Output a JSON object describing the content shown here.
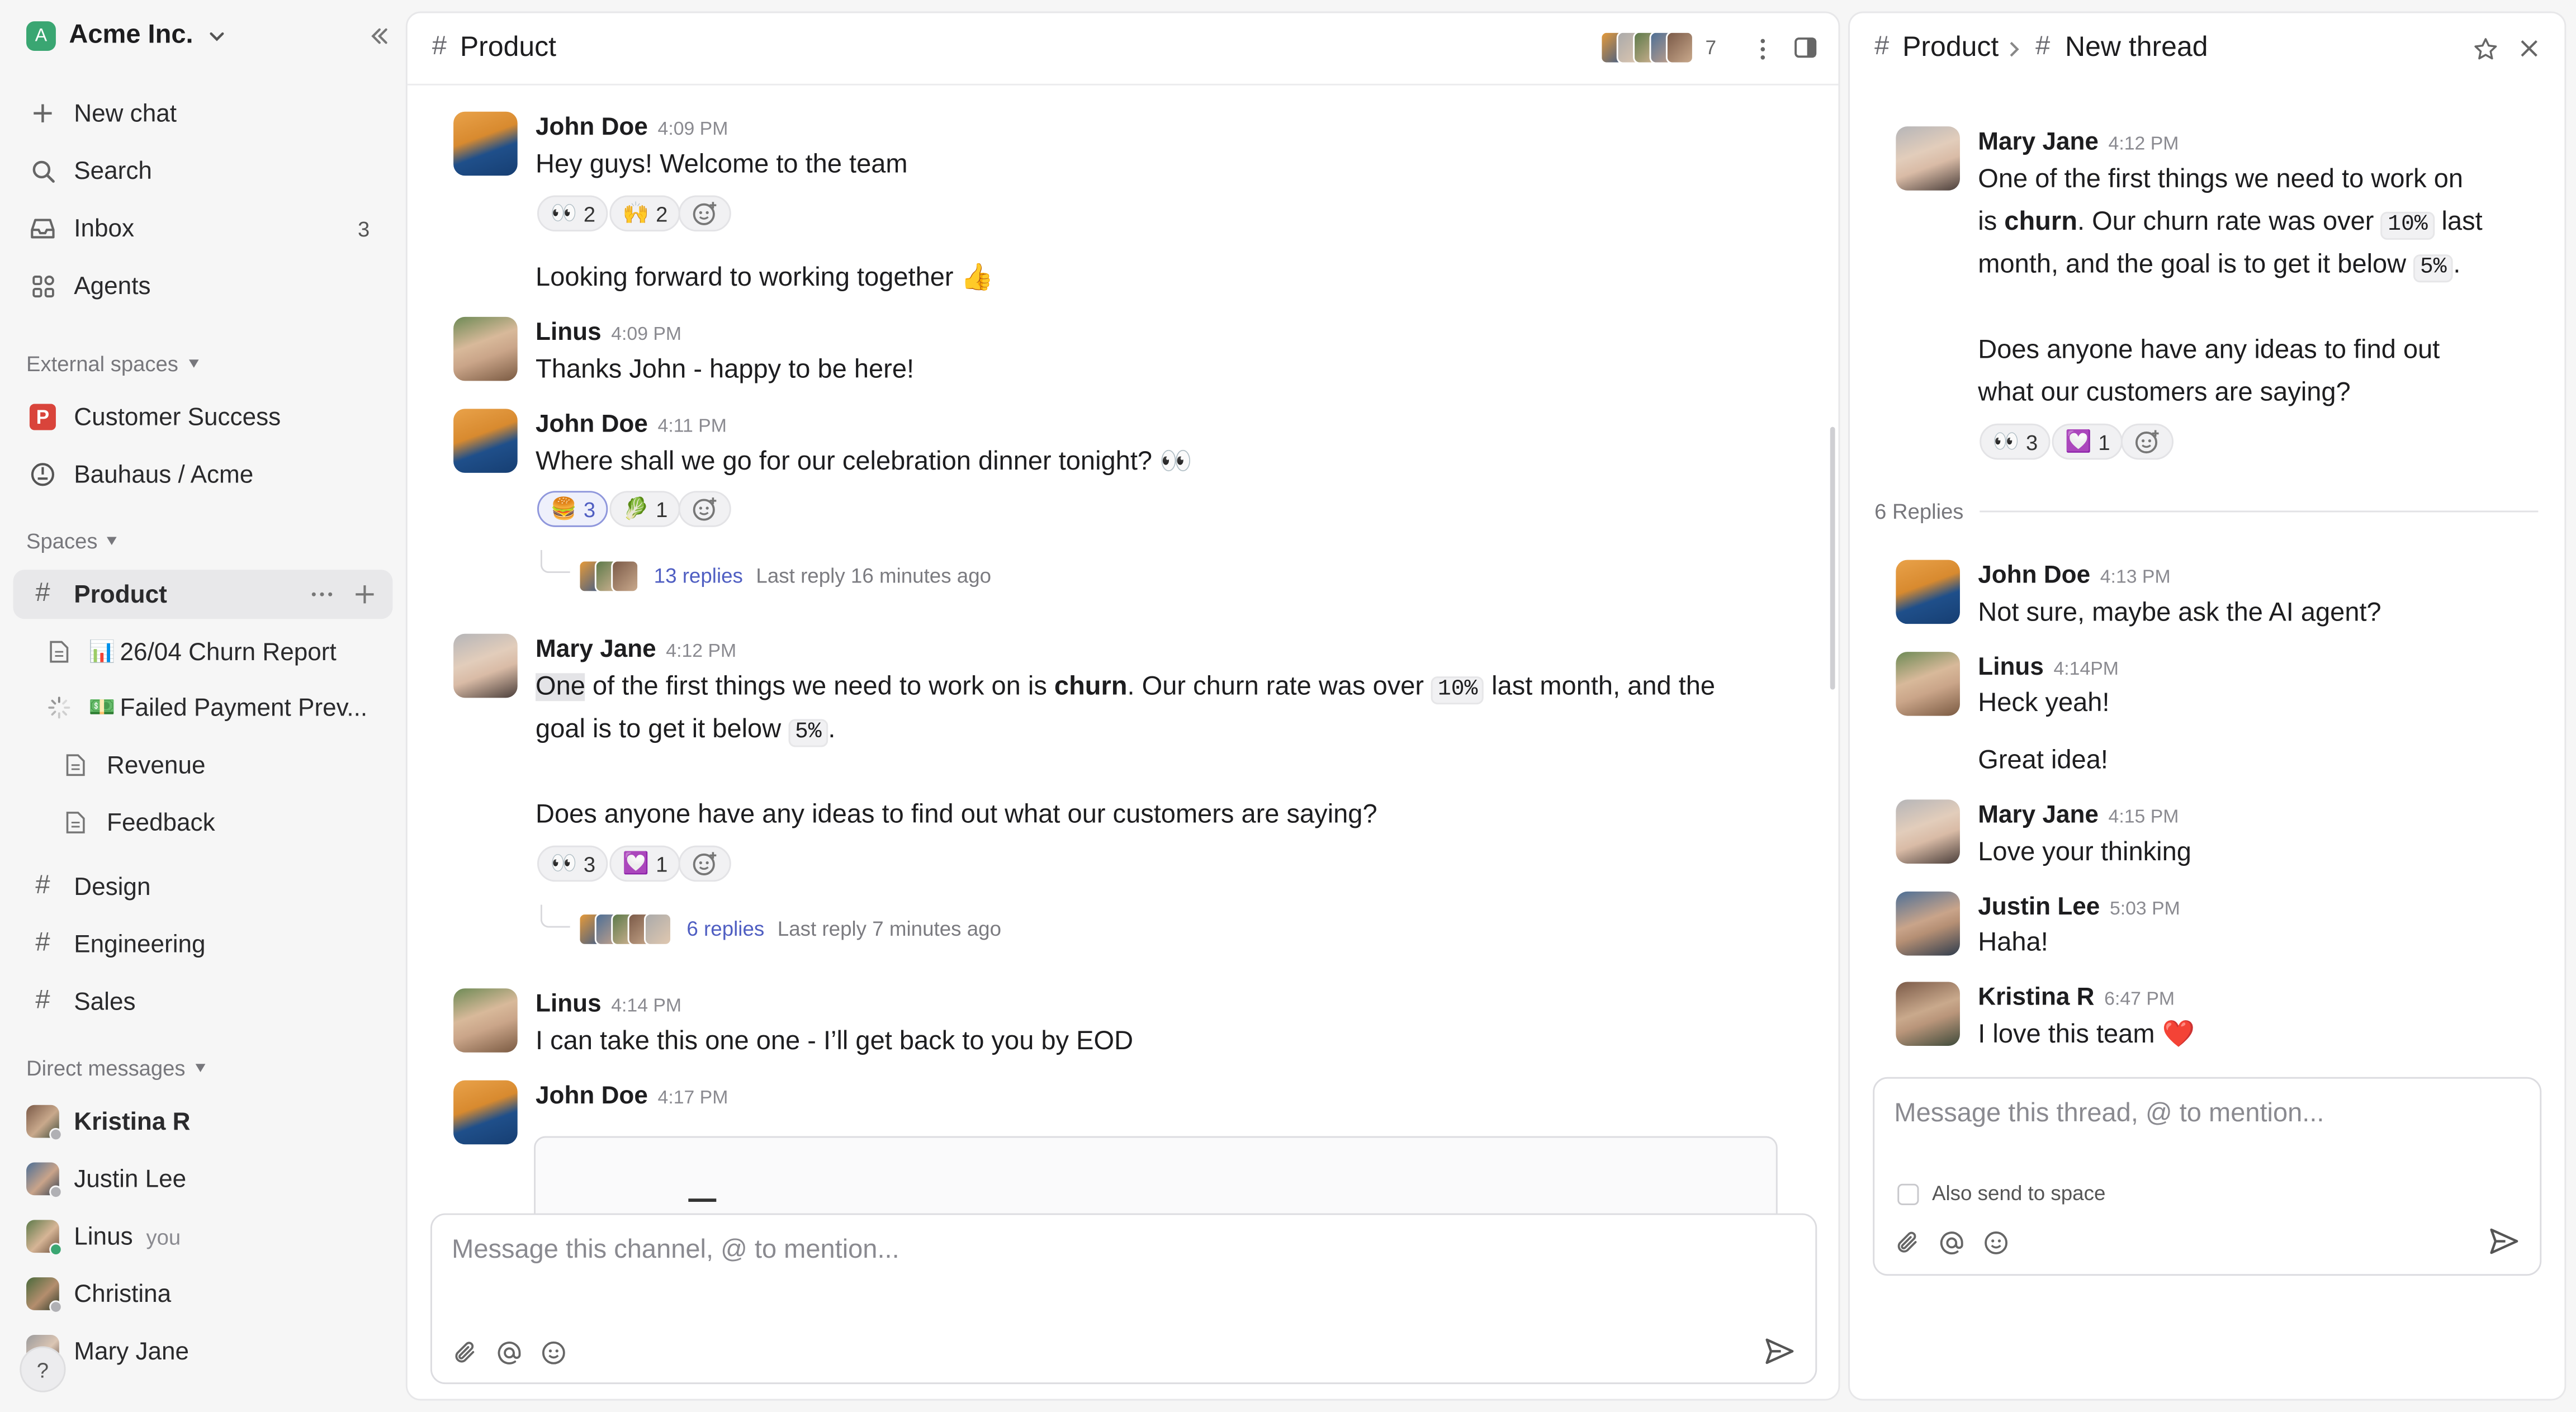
{
  "workspace": {
    "name": "Acme Inc.",
    "initial": "A",
    "color": "#3aa672"
  },
  "sidebar": {
    "nav": [
      {
        "label": "New chat"
      },
      {
        "label": "Search"
      },
      {
        "label": "Inbox",
        "badge": "3"
      },
      {
        "label": "Agents"
      }
    ],
    "external_title": "External spaces",
    "external": [
      {
        "label": "Customer Success"
      },
      {
        "label": "Bauhaus / Acme"
      }
    ],
    "spaces_title": "Spaces",
    "spaces": [
      {
        "label": "Product"
      },
      {
        "label": "Design"
      },
      {
        "label": "Engineering"
      },
      {
        "label": "Sales"
      }
    ],
    "product_children": [
      {
        "emoji": "📊",
        "label": "26/04 Churn Report"
      },
      {
        "emoji": "💵",
        "label": "Failed Payment Prev..."
      },
      {
        "label": "Revenue"
      },
      {
        "label": "Feedback"
      }
    ],
    "dm_title": "Direct messages",
    "dms": [
      {
        "label": "Kristina R"
      },
      {
        "label": "Justin Lee"
      },
      {
        "label": "Linus",
        "suffix": "you"
      },
      {
        "label": "Christina"
      },
      {
        "label": "Mary Jane"
      }
    ],
    "help": "?"
  },
  "channel": {
    "name": "Product",
    "member_count": "7",
    "messages": [
      {
        "author": "John Doe",
        "time": "4:09 PM",
        "text": "Hey guys! Welcome to the team",
        "reactions": [
          {
            "emoji": "👀",
            "count": "2"
          },
          {
            "emoji": "🙌",
            "count": "2"
          }
        ]
      },
      {
        "text": "Looking forward to working together 👍"
      },
      {
        "author": "Linus",
        "time": "4:09 PM",
        "text": "Thanks John - happy to be here!"
      },
      {
        "author": "John Doe",
        "time": "4:11 PM",
        "text": "Where shall we go for our celebration dinner tonight? 👀",
        "reactions": [
          {
            "emoji": "🍔",
            "count": "3"
          },
          {
            "emoji": "🥬",
            "count": "1"
          }
        ],
        "thread": {
          "replies": "13 replies",
          "last": "Last reply 16 minutes ago"
        }
      },
      {
        "author": "Mary Jane",
        "time": "4:12 PM",
        "p1": [
          "One",
          " of the first things we need to work on is ",
          "churn",
          ". Our churn rate was over ",
          "10%",
          " last month, and the"
        ],
        "p2": [
          "goal is to get it below ",
          "5%",
          "."
        ],
        "p3": "Does anyone have any ideas to find out what our customers are saying?",
        "reactions": [
          {
            "emoji": "👀",
            "count": "3"
          },
          {
            "emoji": "💟",
            "count": "1"
          }
        ],
        "thread": {
          "replies": "6 replies",
          "last": "Last reply 7 minutes ago"
        }
      },
      {
        "author": "Linus",
        "time": "4:14 PM",
        "text": "I can take this one one - I’ll get back to you by EOD"
      },
      {
        "author": "John Doe",
        "time": "4:17 PM"
      }
    ],
    "composer_placeholder": "Message this channel, @ to mention..."
  },
  "thread": {
    "crumb_space": "Product",
    "crumb_thread": "New thread",
    "root": {
      "author": "Mary Jane",
      "time": "4:12 PM",
      "l1": "One of the first things we need to work on",
      "l2": [
        "is ",
        "churn",
        ". Our churn rate was over ",
        "10%",
        " last"
      ],
      "l3": [
        "month, and the goal is to get it below ",
        "5%",
        "."
      ],
      "l4": "Does anyone have any ideas to find out",
      "l5": "what our customers are saying?",
      "reactions": [
        {
          "emoji": "👀",
          "count": "3"
        },
        {
          "emoji": "💟",
          "count": "1"
        }
      ]
    },
    "replies_label": "6 Replies",
    "replies": [
      {
        "author": "John Doe",
        "time": "4:13 PM",
        "text": "Not sure, maybe ask the AI agent?"
      },
      {
        "author": "Linus",
        "time": "4:14PM",
        "text": "Heck yeah!"
      },
      {
        "text": "Great idea!"
      },
      {
        "author": "Mary Jane",
        "time": "4:15 PM",
        "text": "Love your thinking"
      },
      {
        "author": "Justin Lee",
        "time": "5:03 PM",
        "text": "Haha!"
      },
      {
        "author": "Kristina R",
        "time": "6:47 PM",
        "text": "I love this team ❤️"
      }
    ],
    "composer_placeholder": "Message this thread, @ to mention...",
    "also_send": "Also send to space"
  },
  "colors": {
    "accent": "#4f5ec2",
    "brand_green": "#3aa672",
    "red_logo": "#d9443b",
    "online": "#3aa672"
  }
}
